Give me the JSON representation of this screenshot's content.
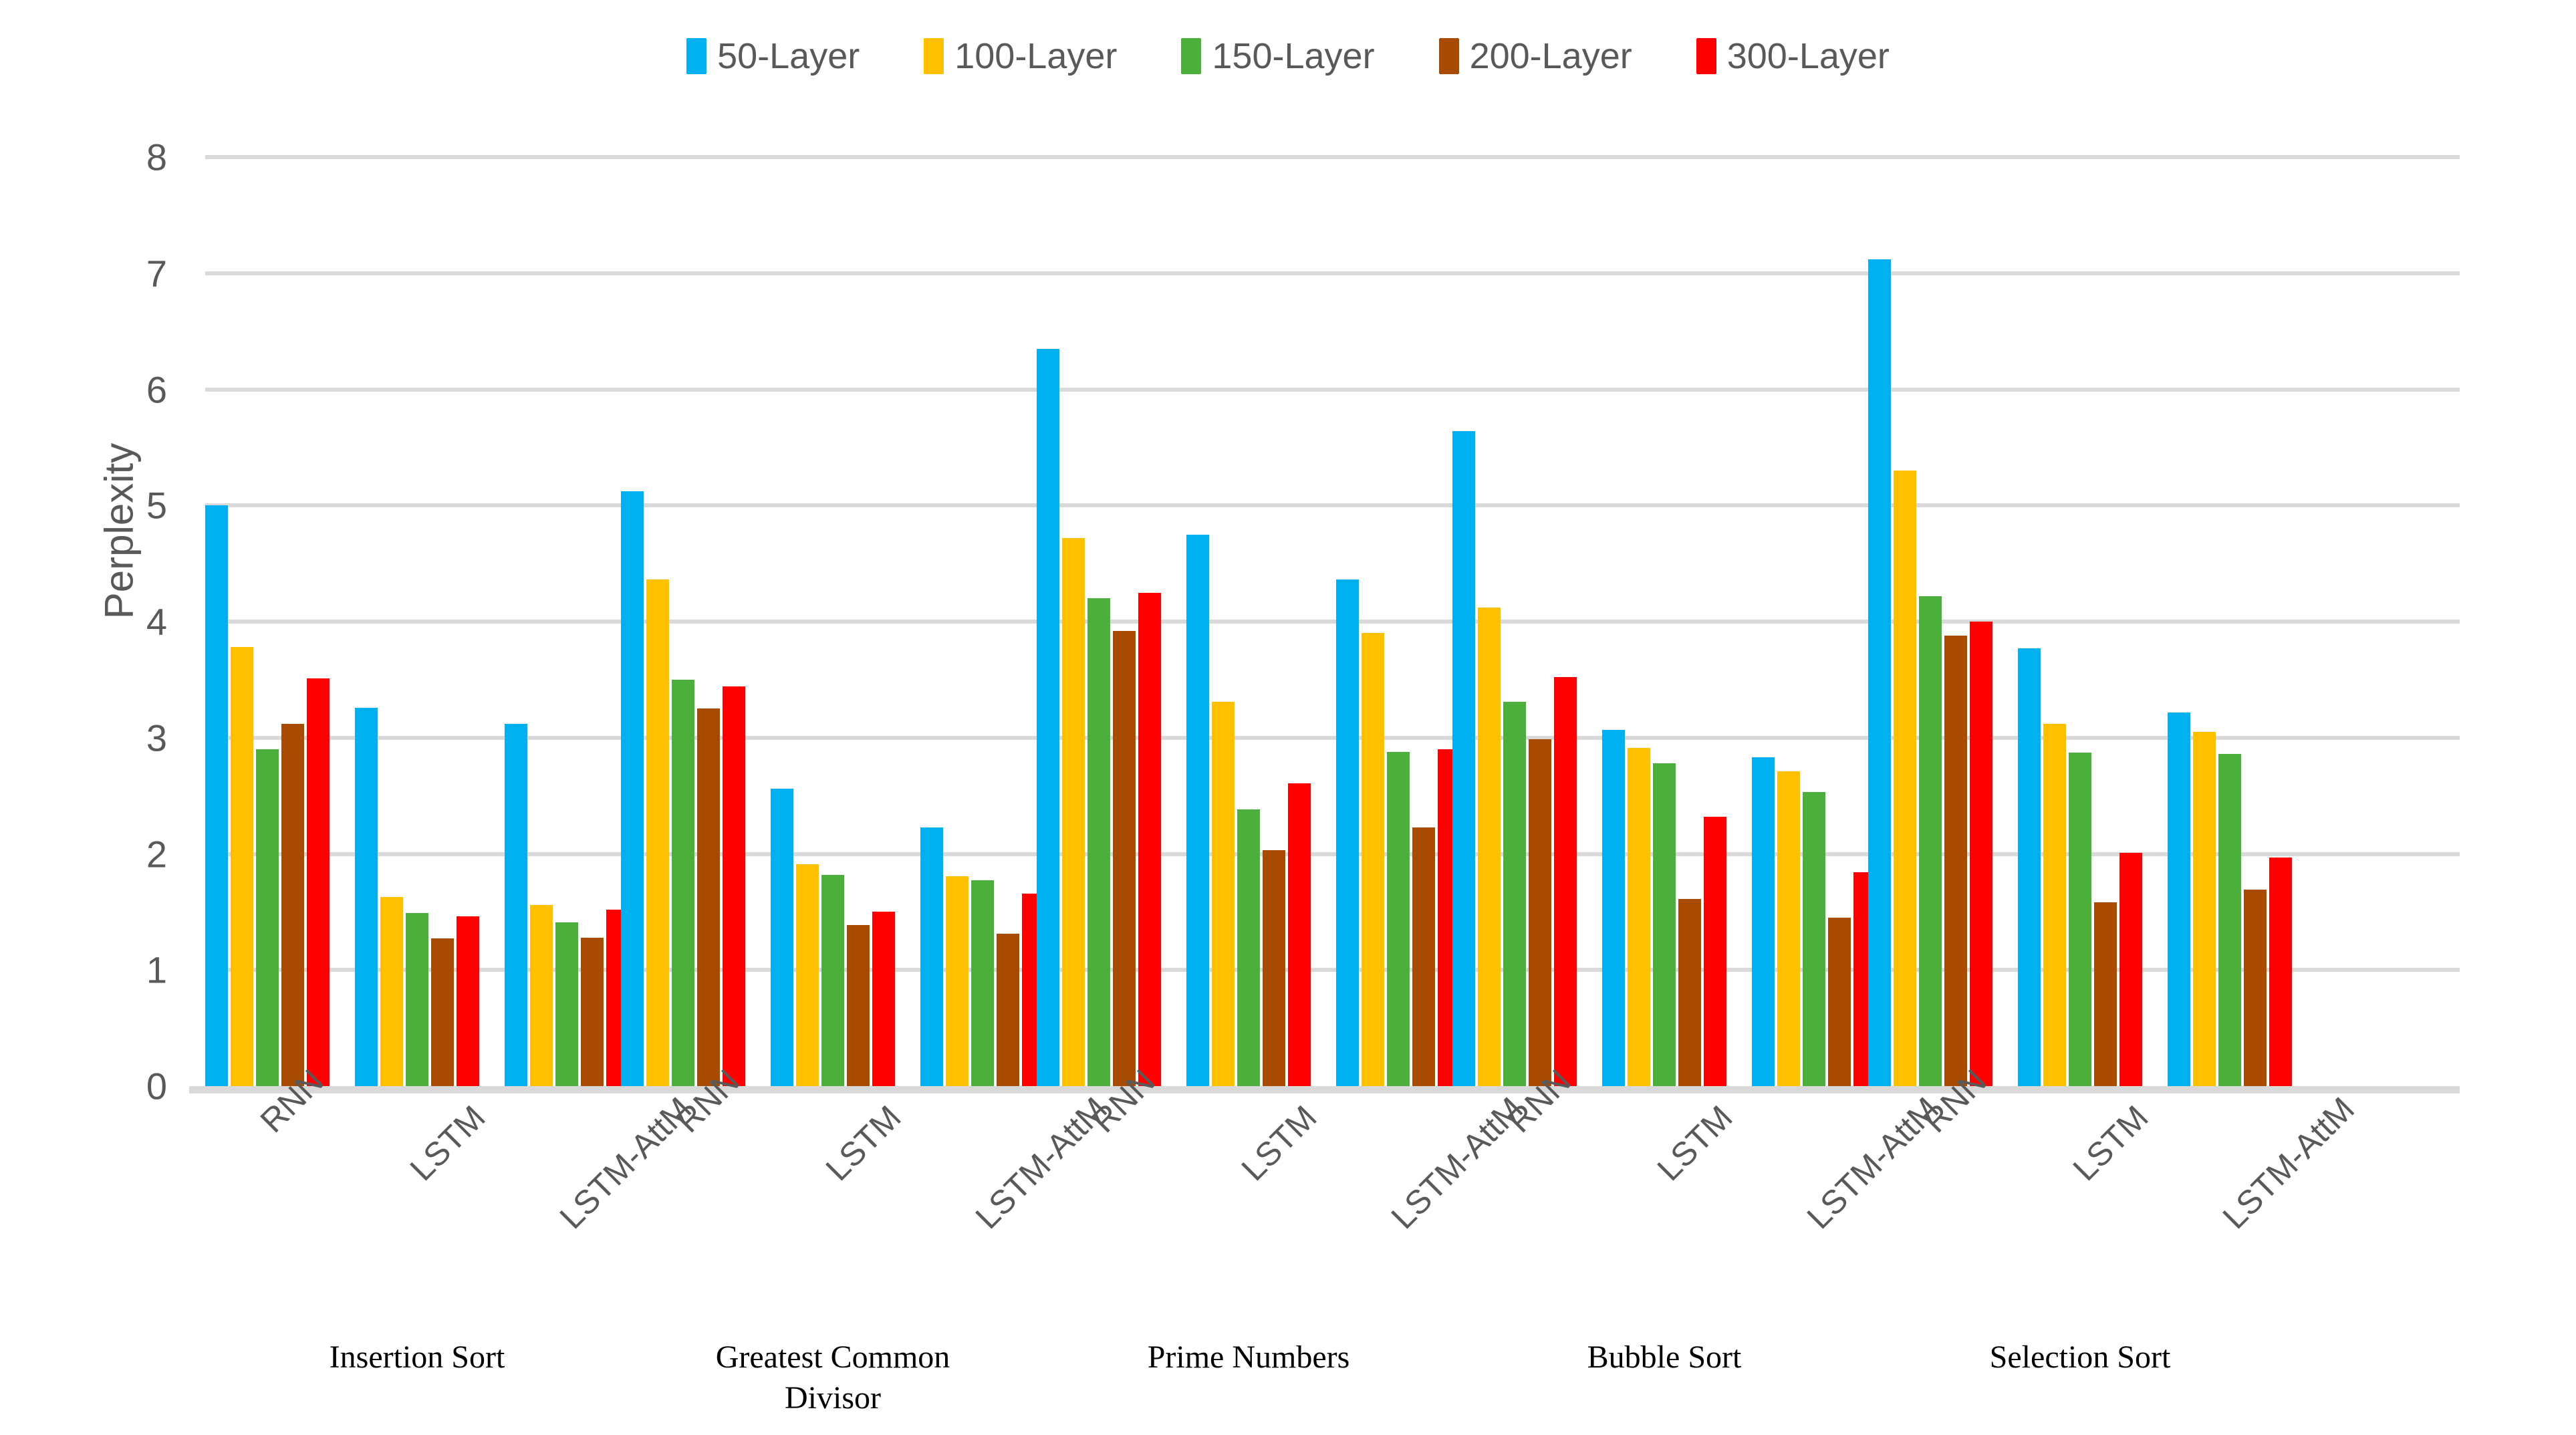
{
  "legend": {
    "position": "top-center",
    "items": [
      {
        "label": "50-Layer",
        "color": "#00B0F0"
      },
      {
        "label": "100-Layer",
        "color": "#FFC000"
      },
      {
        "label": "150-Layer",
        "color": "#4CAF3C"
      },
      {
        "label": "200-Layer",
        "color": "#A84A00"
      },
      {
        "label": "300-Layer",
        "color": "#FF0000"
      }
    ]
  },
  "axis": {
    "y_title": "Perplexity",
    "y_ticks": [
      "0",
      "1",
      "2",
      "3",
      "4",
      "5",
      "6",
      "7",
      "8"
    ]
  },
  "chart_data": {
    "type": "bar",
    "title": "",
    "subtitle": "",
    "xlabel": "",
    "ylabel": "Perplexity",
    "ylim": [
      0,
      8
    ],
    "ytick_step": 1,
    "grid": "horizontal",
    "legend_position": "top-center",
    "series": [
      {
        "name": "50-Layer",
        "color": "#00B0F0"
      },
      {
        "name": "100-Layer",
        "color": "#FFC000"
      },
      {
        "name": "150-Layer",
        "color": "#4CAF3C"
      },
      {
        "name": "200-Layer",
        "color": "#A84A00"
      },
      {
        "name": "300-Layer",
        "color": "#FF0000"
      }
    ],
    "models": [
      "RNN",
      "LSTM",
      "LSTM-AttM"
    ],
    "groups": [
      {
        "name": "Insertion Sort",
        "caption_lines": [
          "Insertion Sort"
        ],
        "models": [
          {
            "model": "RNN",
            "values": [
              5.0,
              3.78,
              2.9,
              3.12,
              3.51
            ]
          },
          {
            "model": "LSTM",
            "values": [
              3.26,
              1.63,
              1.49,
              1.27,
              1.46
            ]
          },
          {
            "model": "LSTM-AttM",
            "values": [
              3.12,
              1.56,
              1.41,
              1.28,
              1.52
            ]
          }
        ]
      },
      {
        "name": "Greatest Common Divisor",
        "caption_lines": [
          "Greatest Common",
          "Divisor"
        ],
        "models": [
          {
            "model": "RNN",
            "values": [
              5.12,
              4.36,
              3.5,
              3.25,
              3.44
            ]
          },
          {
            "model": "LSTM",
            "values": [
              2.56,
              1.91,
              1.82,
              1.39,
              1.5
            ]
          },
          {
            "model": "LSTM-AttM",
            "values": [
              2.23,
              1.81,
              1.77,
              1.31,
              1.66
            ]
          }
        ]
      },
      {
        "name": "Prime Numbers",
        "caption_lines": [
          "Prime Numbers"
        ],
        "models": [
          {
            "model": "RNN",
            "values": [
              6.35,
              4.72,
              4.2,
              3.92,
              4.25
            ]
          },
          {
            "model": "LSTM",
            "values": [
              4.75,
              3.31,
              2.38,
              2.03,
              2.61
            ]
          },
          {
            "model": "LSTM-AttM",
            "values": [
              4.36,
              3.9,
              2.88,
              2.23,
              2.9
            ]
          }
        ]
      },
      {
        "name": "Bubble Sort",
        "caption_lines": [
          "Bubble Sort"
        ],
        "models": [
          {
            "model": "RNN",
            "values": [
              5.64,
              4.12,
              3.31,
              2.99,
              3.52
            ]
          },
          {
            "model": "LSTM",
            "values": [
              3.07,
              2.91,
              2.78,
              1.61,
              2.32
            ]
          },
          {
            "model": "LSTM-AttM",
            "values": [
              2.83,
              2.71,
              2.53,
              1.45,
              1.84
            ]
          }
        ]
      },
      {
        "name": "Selection Sort",
        "caption_lines": [
          "Selection Sort"
        ],
        "models": [
          {
            "model": "RNN",
            "values": [
              7.12,
              5.3,
              4.22,
              3.88,
              4.0
            ]
          },
          {
            "model": "LSTM",
            "values": [
              3.77,
              3.12,
              2.87,
              1.58,
              2.01
            ]
          },
          {
            "model": "LSTM-AttM",
            "values": [
              3.22,
              3.05,
              2.86,
              1.69,
              1.97
            ]
          }
        ]
      }
    ]
  }
}
